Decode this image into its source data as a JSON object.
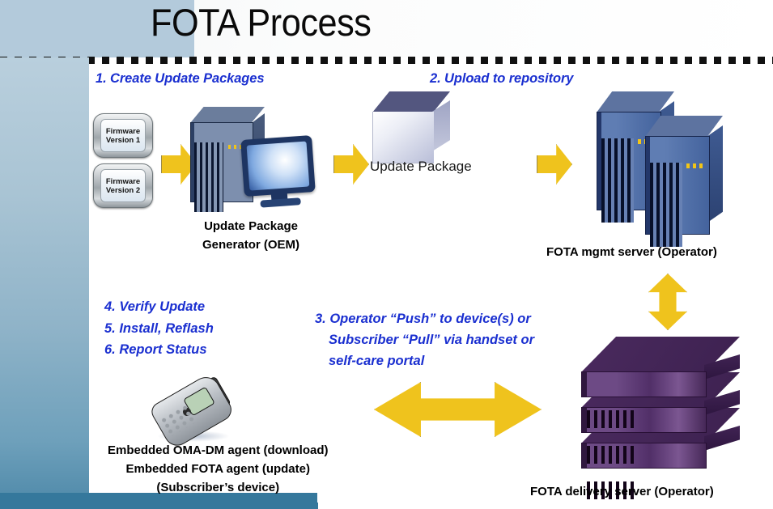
{
  "header": {
    "title": "FOTA Process"
  },
  "steps": {
    "step1": "1.  Create Update Packages",
    "step2": "2.  Upload to repository",
    "step3": {
      "line1": "3. Operator “Push” to device(s) or",
      "line2": "Subscriber “Pull” via handset or",
      "line3": "self-care portal"
    },
    "step4": "4.  Verify Update",
    "step5": "5.  Install, Reflash",
    "step6": "6.  Report Status"
  },
  "nodes": {
    "firmware1": {
      "line1": "Firmware",
      "line2": "Version 1"
    },
    "firmware2": {
      "line1": "Firmware",
      "line2": "Version 2"
    },
    "generator": {
      "line1": "Update Package",
      "line2": "Generator (OEM)"
    },
    "update_package_label": "Update Package",
    "mgmt_server": "FOTA mgmt server (Operator)",
    "delivery_server": "FOTA delivery server (Operator)",
    "device": {
      "line1": "Embedded OMA-DM agent (download)",
      "line2": "Embedded FOTA agent (update)",
      "line3": "(Subscriber’s device)"
    }
  },
  "colors": {
    "step_text": "#1a2fd0",
    "arrow_fill": "#efc31d",
    "arrow_outline": "#9a8a4a",
    "sidebar_top": "#b9cfdd",
    "sidebar_bottom": "#4d88a8",
    "bottom_bar": "#35789c",
    "header_blob": "#b3cadb",
    "mgmt_server": "#44639d",
    "delivery_server": "#512f68",
    "caption_text": "#000000"
  }
}
